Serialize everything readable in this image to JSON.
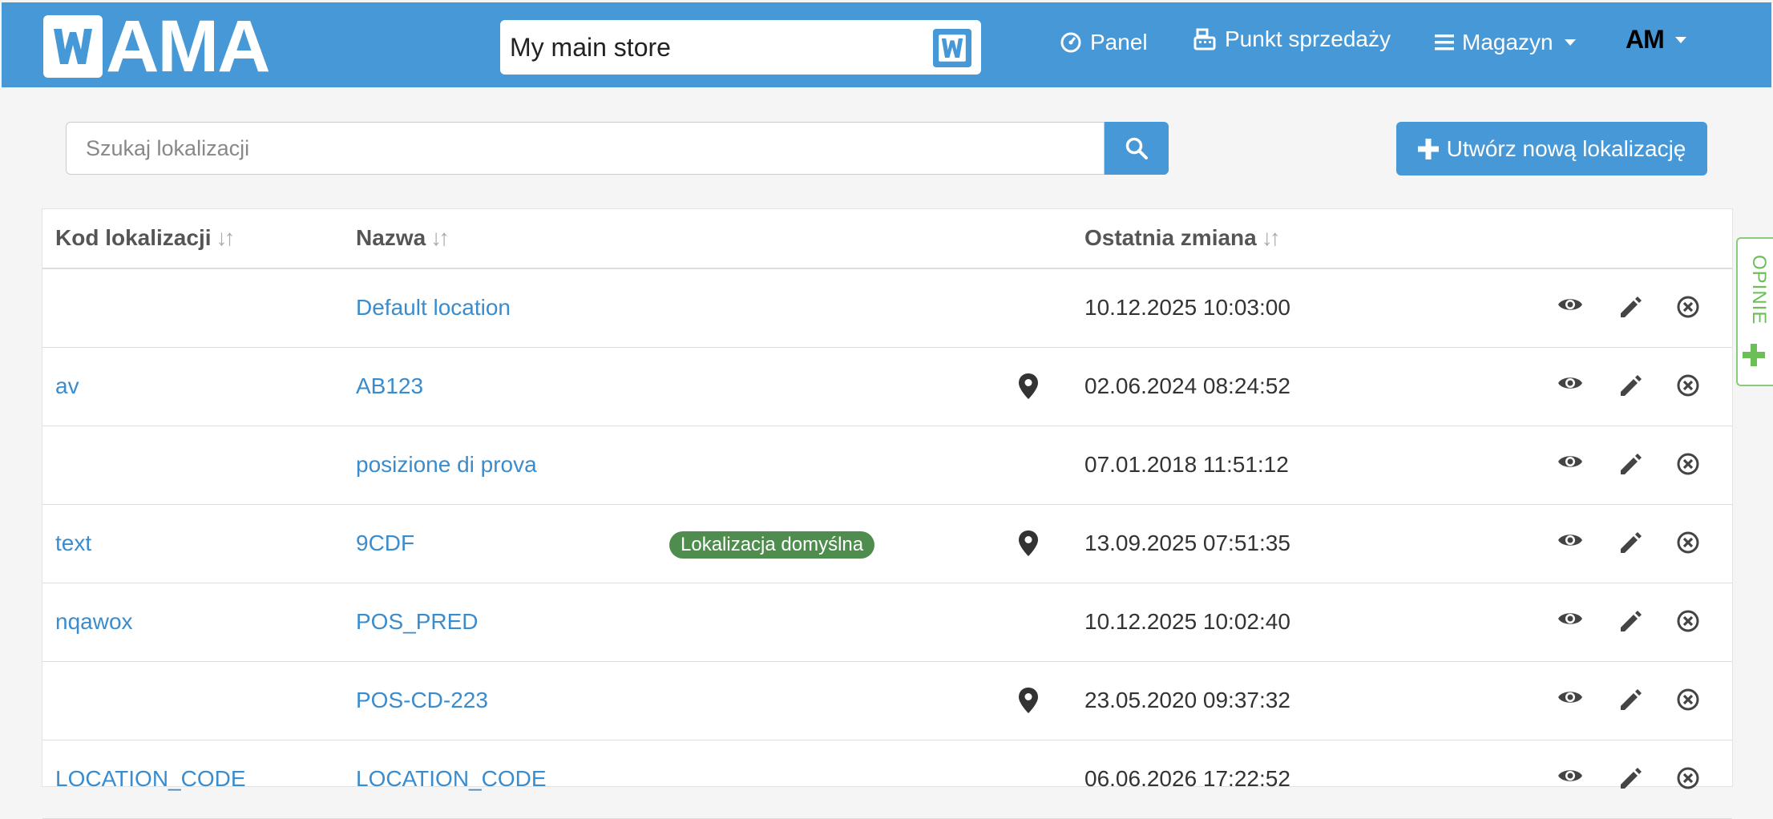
{
  "header": {
    "logo_text": "AMA",
    "store_name": "My main store",
    "nav": [
      {
        "label": "Panel",
        "icon": "dashboard-icon"
      },
      {
        "label": "Punkt sprzedaży",
        "icon": "cash-register-icon"
      },
      {
        "label": "Magazyn",
        "icon": "hamburger-icon"
      }
    ],
    "user_logo_text": "AM"
  },
  "search": {
    "placeholder": "Szukaj lokalizacji",
    "value": ""
  },
  "create_button": {
    "label": "Utwórz nową lokalizację"
  },
  "table": {
    "columns": [
      "Kod lokalizacji",
      "Nazwa",
      "Ostatnia zmiana"
    ],
    "rows": [
      {
        "code": "",
        "name": "Default location",
        "badge": "",
        "pin": false,
        "date": "10.12.2025 10:03:00"
      },
      {
        "code": "av",
        "name": "AB123",
        "badge": "",
        "pin": true,
        "date": "02.06.2024 08:24:52"
      },
      {
        "code": "",
        "name": "posizione di prova",
        "badge": "",
        "pin": false,
        "date": "07.01.2018 11:51:12"
      },
      {
        "code": "text",
        "name": "9CDF",
        "badge": "Lokalizacja domyślna",
        "pin": true,
        "date": "13.09.2025 07:51:35"
      },
      {
        "code": "nqawox",
        "name": "POS_PRED",
        "badge": "",
        "pin": false,
        "date": "10.12.2025 10:02:40"
      },
      {
        "code": "",
        "name": "POS-CD-223",
        "badge": "",
        "pin": true,
        "date": "23.05.2020 09:37:32"
      },
      {
        "code": "LOCATION_CODE",
        "name": "LOCATION_CODE",
        "badge": "",
        "pin": false,
        "date": "06.06.2026 17:22:52"
      }
    ]
  },
  "feedback": {
    "label": "OPINIE"
  },
  "colors": {
    "primary": "#4798d6",
    "link": "#3a8ccd",
    "badge": "#4f8d4f",
    "feedback": "#6cbf57"
  }
}
